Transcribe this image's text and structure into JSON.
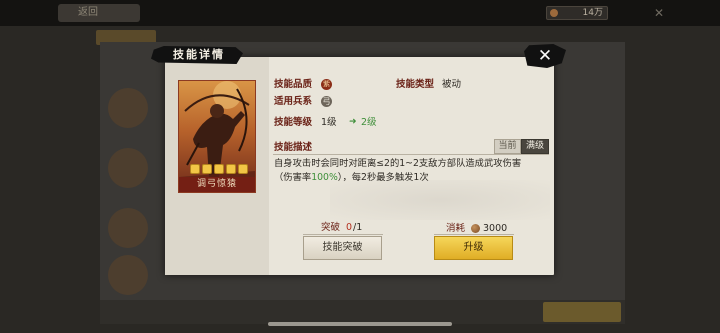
{
  "background": {
    "back_label": "返回",
    "resource_value": "14万"
  },
  "modal": {
    "title": "技能详情",
    "close_symbol": "✕",
    "card": {
      "name": "调弓惊猿",
      "stars": 5
    },
    "fields": {
      "quality_label": "技能品质",
      "quality_badge": "紫",
      "type_label": "技能类型",
      "type_value": "被动",
      "troop_label": "适用兵系",
      "troop_badge": "弓",
      "level_label": "技能等级",
      "level_value": "1级",
      "level_arrow": "➜",
      "next_level_value": "2级"
    },
    "description": {
      "label": "技能描述",
      "tab_current": "当前",
      "tab_max": "满级",
      "line1_text": "自身攻击时会同时对距离≤2的1~2支敌方部队造成武攻伤害",
      "line2_prefix": "（伤害率",
      "line2_rate": "100%",
      "line2_suffix": "），每2秒最多触发1次"
    },
    "footer": {
      "breakthrough_label": "突破",
      "breakthrough_current": "0",
      "breakthrough_total": "/1",
      "breakthrough_button": "技能突破",
      "cost_label": "消耗",
      "cost_value": "3000",
      "upgrade_button": "升级"
    }
  },
  "colors": {
    "accent_gold": "#e0ad25",
    "label_red": "#6b2318",
    "highlight_green": "#3f8f3a",
    "breakthrough_red": "#b3301f"
  }
}
